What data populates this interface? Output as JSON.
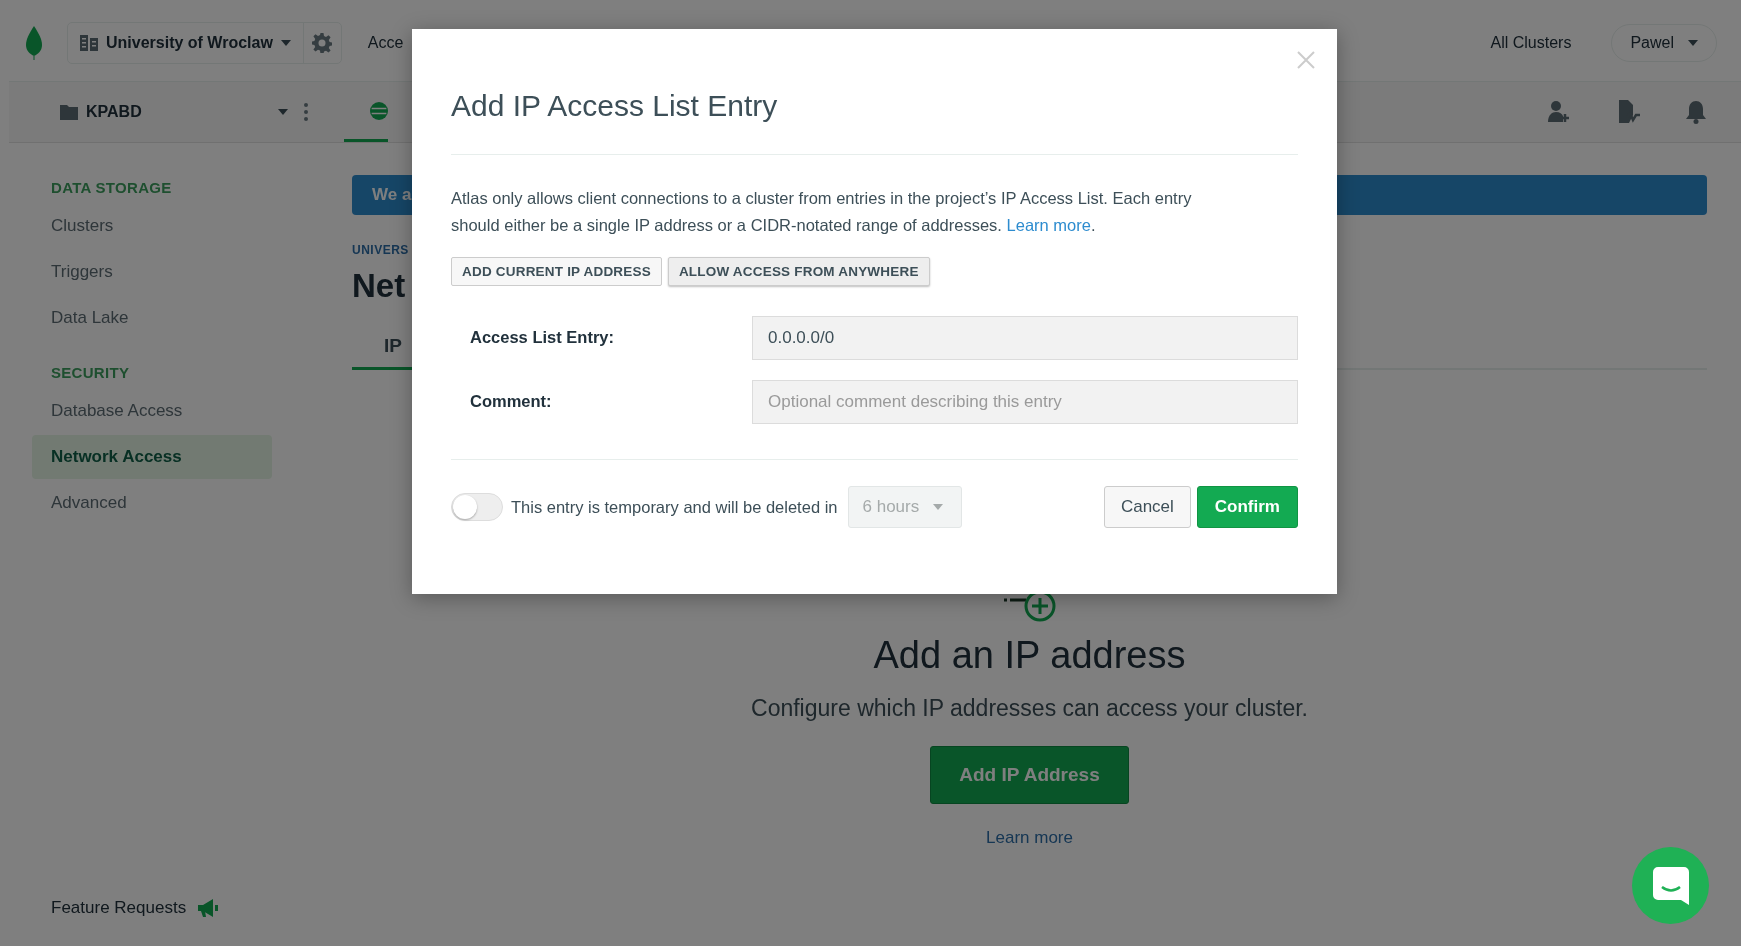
{
  "top_bar": {
    "organization": "University of Wroclaw",
    "nav_partial": "Acce",
    "all_clusters": "All Clusters",
    "user": "Pawel"
  },
  "project_bar": {
    "project": "KPABD"
  },
  "sidebar": {
    "sections": [
      {
        "title": "DATA STORAGE",
        "items": [
          {
            "label": "Clusters",
            "selected": false
          },
          {
            "label": "Triggers",
            "selected": false
          },
          {
            "label": "Data Lake",
            "selected": false
          }
        ]
      },
      {
        "title": "SECURITY",
        "items": [
          {
            "label": "Database Access",
            "selected": false
          },
          {
            "label": "Network Access",
            "selected": true
          },
          {
            "label": "Advanced",
            "selected": false
          }
        ]
      }
    ],
    "footer": "Feature Requests"
  },
  "main": {
    "banner": "We a",
    "breadcrumb": "UNIVERS",
    "title": "Net",
    "tabs": [
      {
        "label": "IP",
        "selected": true
      }
    ],
    "empty_state": {
      "title": "Add an IP address",
      "description": "Configure which IP addresses can access your cluster.",
      "button": "Add IP Address",
      "link": "Learn more"
    }
  },
  "modal": {
    "title": "Add IP Access List Entry",
    "description": "Atlas only allows client connections to a cluster from entries in the project’s IP Access List. Each entry should either be a single IP address or a CIDR-notated range of addresses.",
    "link": "Learn more",
    "link_suffix": ".",
    "quick_buttons": [
      {
        "label": "ADD CURRENT IP ADDRESS",
        "selected": false
      },
      {
        "label": "ALLOW ACCESS FROM ANYWHERE",
        "selected": true
      }
    ],
    "fields": [
      {
        "label": "Access List Entry:",
        "value": "0.0.0.0/0"
      },
      {
        "label": "Comment:",
        "placeholder": "Optional comment describing this entry"
      }
    ],
    "temporary": {
      "on": false,
      "label": "This entry is temporary and will be deleted in",
      "duration": "6 hours",
      "disabled": true
    },
    "cancel": "Cancel",
    "confirm": "Confirm"
  }
}
